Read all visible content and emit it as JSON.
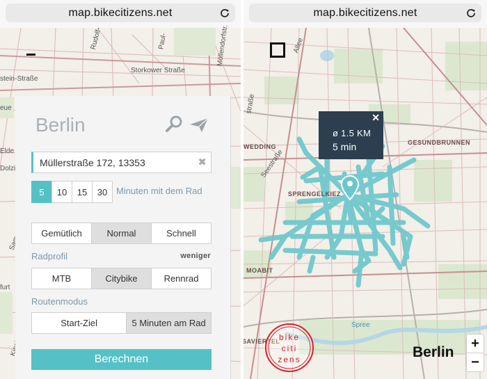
{
  "browser": {
    "left_url": "map.bikecitizens.net",
    "right_url": "map.bikecitizens.net"
  },
  "left_map": {
    "streets": [
      "Storkower Straße",
      "Rudolf-",
      "Paul-",
      "Möllendorfstr.",
      "stein-Straße",
      "eue",
      "Elde",
      "Dolzig",
      "Samariterst",
      "furt",
      "Kinzigstraße"
    ]
  },
  "panel": {
    "city": "Berlin",
    "address": "Müllerstraße 172, 13353",
    "minutes": [
      {
        "label": "5",
        "active": true
      },
      {
        "label": "10",
        "active": false
      },
      {
        "label": "15",
        "active": false
      },
      {
        "label": "30",
        "active": false
      }
    ],
    "minutes_label": "Minuten mit dem Rad",
    "speed": [
      {
        "label": "Gemütlich",
        "active": false
      },
      {
        "label": "Normal",
        "active": true
      },
      {
        "label": "Schnell",
        "active": false
      }
    ],
    "profile_label": "Radprofil",
    "less_label": "weniger",
    "profiles": [
      {
        "label": "MTB",
        "active": false
      },
      {
        "label": "Citybike",
        "active": true
      },
      {
        "label": "Rennrad",
        "active": false
      }
    ],
    "route_mode_label": "Routenmodus",
    "route_modes": [
      {
        "label": "Start-Ziel",
        "active": false
      },
      {
        "label": "5 Minuten am Rad",
        "active": true
      }
    ],
    "calculate": "Berechnen"
  },
  "right_map": {
    "popup": {
      "close": "✕",
      "distance": "ø 1.5 KM",
      "time": "5 min"
    },
    "districts": [
      "WEDDING",
      "GESUNDBRUNNEN",
      "SPRENGELKIEZ",
      "MOABIT",
      "SAVIERTEL"
    ],
    "streets": [
      "Seestraße",
      "Allee",
      "straße",
      "Spree"
    ],
    "logo_lines": [
      "bike",
      "citi",
      "zens"
    ],
    "city": "Berlin",
    "zoom_in": "+",
    "zoom_out": "−",
    "colors": {
      "isochrone": "#6cc7cc",
      "accent": "#55c1c7",
      "popup": "#2c3e50",
      "logo": "#d6202a"
    }
  }
}
